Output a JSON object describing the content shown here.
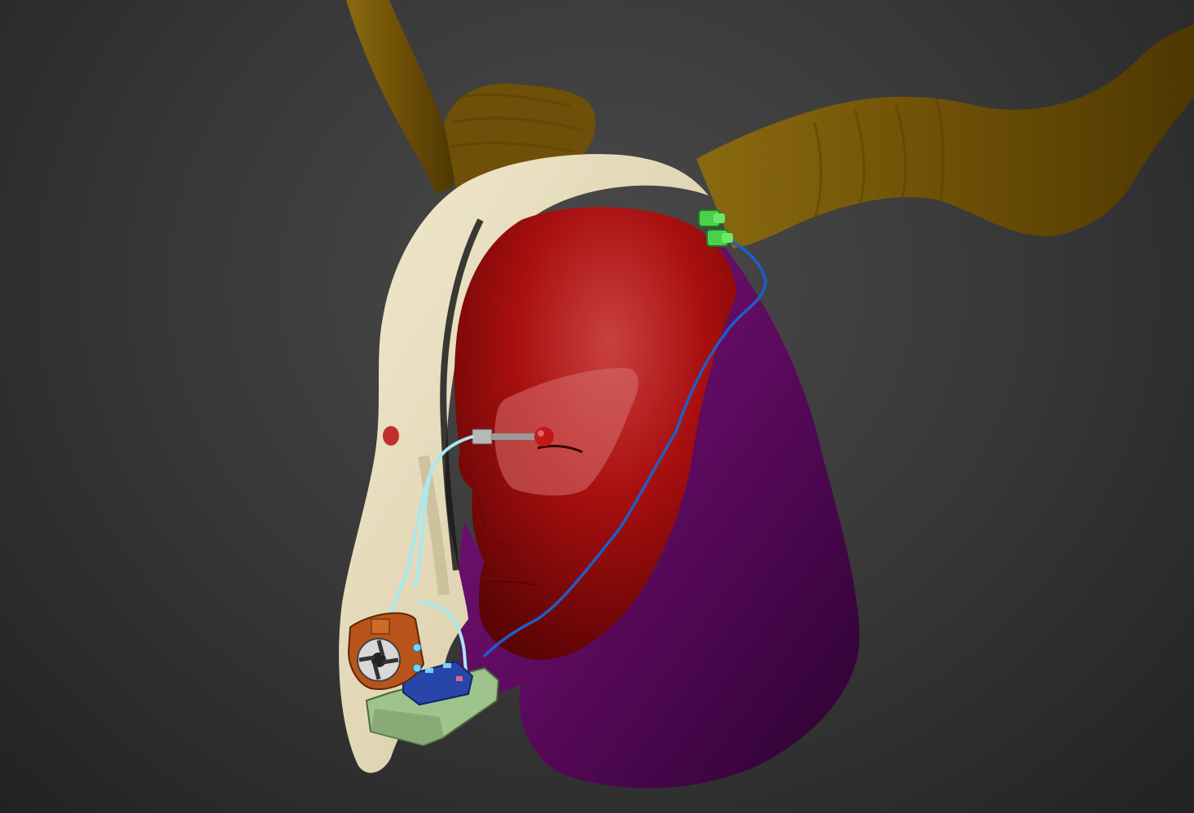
{
  "viewport": {
    "background_color": "#3a3a3a",
    "model_parts": [
      {
        "name": "horn-left",
        "color": "#7a5a08"
      },
      {
        "name": "horn-right",
        "color": "#7a5a08"
      },
      {
        "name": "skull-shell",
        "color": "#e8dfc0"
      },
      {
        "name": "hood",
        "color": "#5c0a5e"
      },
      {
        "name": "face-mask",
        "color": "#b01010"
      },
      {
        "name": "eye-visor",
        "color": "#c96060"
      },
      {
        "name": "eye-probe",
        "color": "#9a9a9a"
      },
      {
        "name": "wire-light-blue",
        "color": "#a8e8f0"
      },
      {
        "name": "wire-blue",
        "color": "#1e5ec8"
      },
      {
        "name": "green-connectors",
        "color": "#4ad04a"
      },
      {
        "name": "fan-module",
        "color": "#b8541a"
      },
      {
        "name": "circuit-board",
        "color": "#2846a8"
      },
      {
        "name": "battery-base",
        "color": "#9ec48c"
      }
    ]
  }
}
